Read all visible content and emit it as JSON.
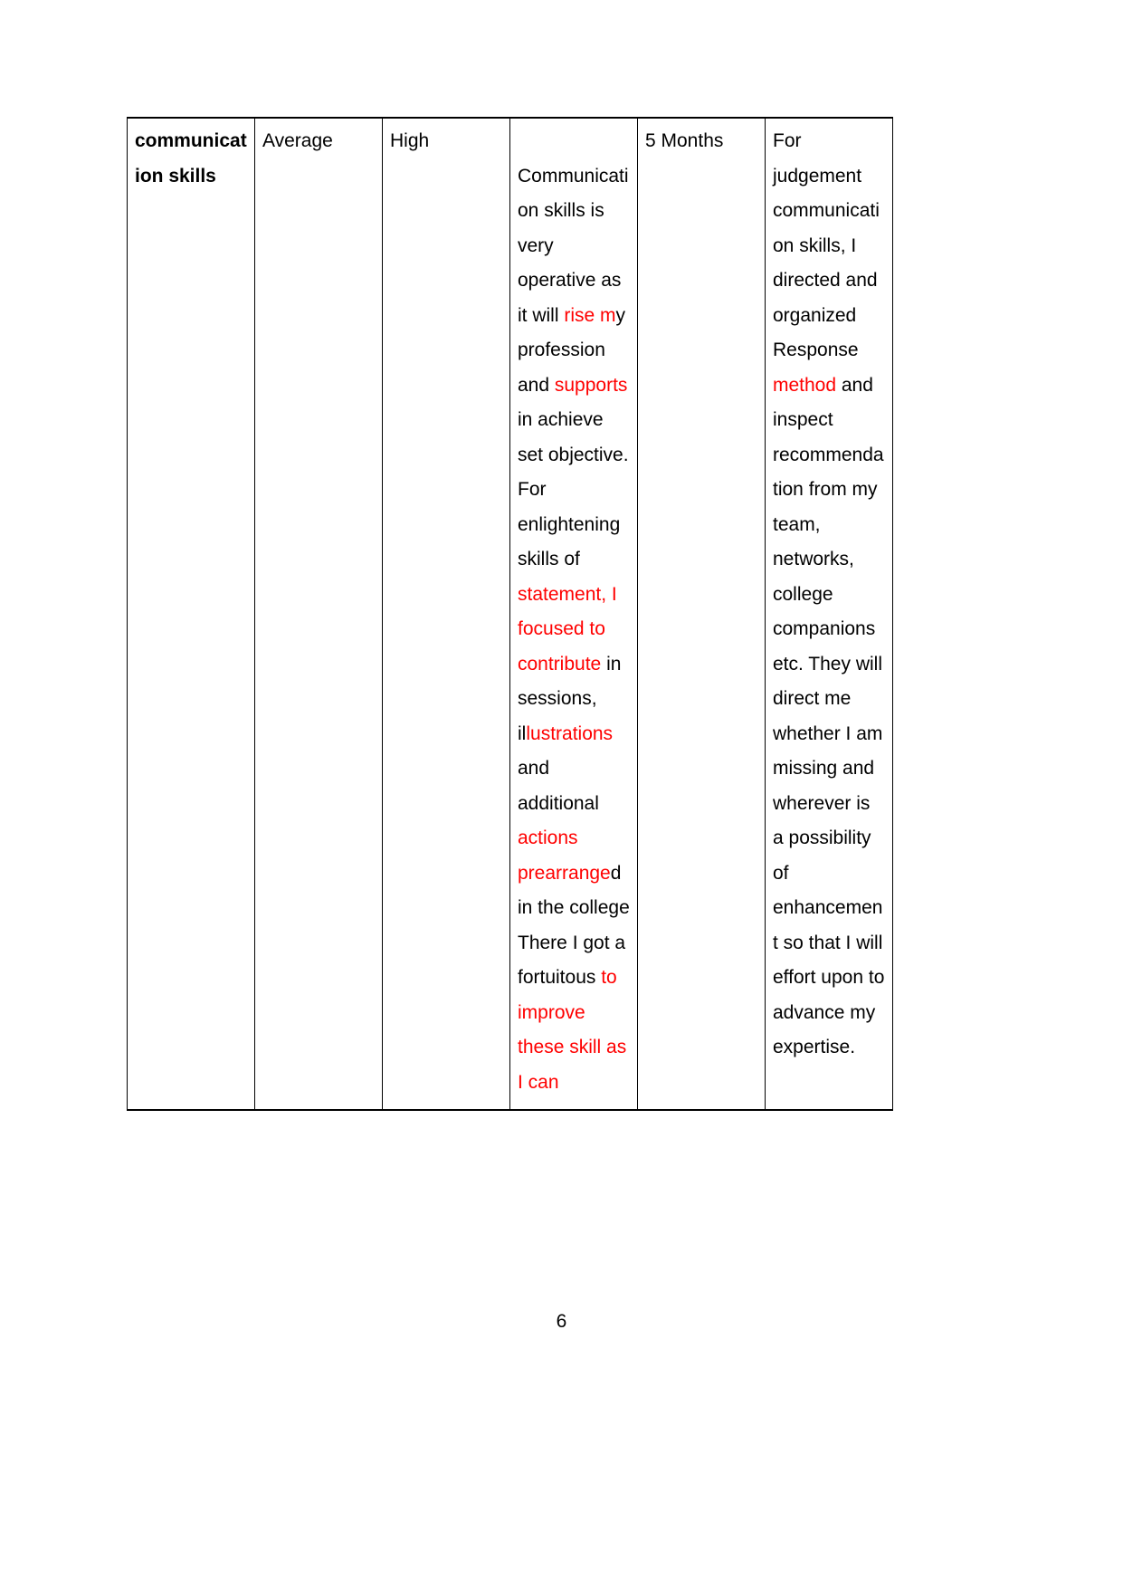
{
  "document": {
    "page_number": "6",
    "accent_insert_color": "#ff0000",
    "text_color": "#000000"
  },
  "table": {
    "row": {
      "skill_name": "communication skills",
      "current_level": "Average",
      "target_level": "High",
      "development_opportunity_segments": [
        {
          "text": "Communication skills is very operative as it will ",
          "style": "normal"
        },
        {
          "text": "rise m",
          "style": "insert"
        },
        {
          "text": "y profession and ",
          "style": "normal"
        },
        {
          "text": "supports",
          "style": "insert"
        },
        {
          "text": " in achieve set objective. For enlightening skills of ",
          "style": "normal"
        },
        {
          "text": "statement, I focused to contribute",
          "style": "insert"
        },
        {
          "text": " in sessions, il",
          "style": "normal"
        },
        {
          "text": "lustrations",
          "style": "insert"
        },
        {
          "text": " and additional ",
          "style": "normal"
        },
        {
          "text": "actions prearrange",
          "style": "insert"
        },
        {
          "text": "d in the college There I got a fortuitous ",
          "style": "normal"
        },
        {
          "text": "to improve these skill as I can",
          "style": "insert"
        }
      ],
      "development_opportunity_plain": "Communication skills is very operative as it will rise my profession and supports in achieve set objective. For enlightening skills of statement, I focused to contribute in sessions, illustrations and additional actions prearranged in the college There I got a fortuitous to improve these skill as I can",
      "time_scale": "5 Months",
      "criteria_for_success_segments": [
        {
          "text": "For judgement communication skills, I directed and organized Response ",
          "style": "normal"
        },
        {
          "text": "method",
          "style": "insert"
        },
        {
          "text": " and inspect recommendation from my team, networks, college companions etc. They will direct me whether I am missing and wherever is a possibility of enhancement so that I will effort upon to advance my expertise.",
          "style": "normal"
        }
      ],
      "criteria_for_success_plain": "For judgement communication skills, I directed and organized Response method and inspect recommendation from my team, networks, college companions etc. They will direct me whether I am missing and wherever is a possibility of enhancement so that I will effort upon to advance my expertise."
    }
  }
}
